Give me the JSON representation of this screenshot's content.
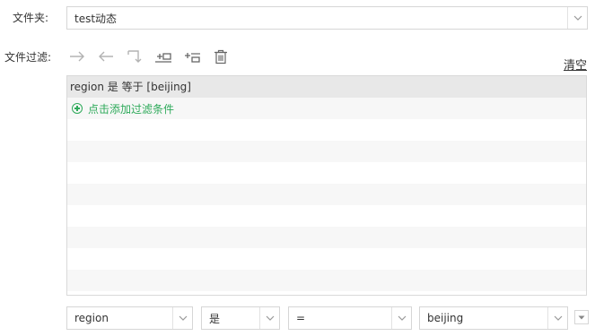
{
  "folder": {
    "label": "文件夹:",
    "value": "test动态"
  },
  "filter": {
    "label": "文件过滤:",
    "clear_label": "清空",
    "toolbar_icons": [
      "arrow-right-icon",
      "arrow-left-icon",
      "branch-icon",
      "insert-condition-icon",
      "add-condition-icon",
      "delete-icon"
    ],
    "condition_text": "region 是 等于 [beijing]",
    "add_condition_label": "点击添加过滤条件",
    "accent_color": "#2eaa5a"
  },
  "editor": {
    "field": "region",
    "operator_not": "是",
    "operator": "=",
    "value": "beijing"
  }
}
